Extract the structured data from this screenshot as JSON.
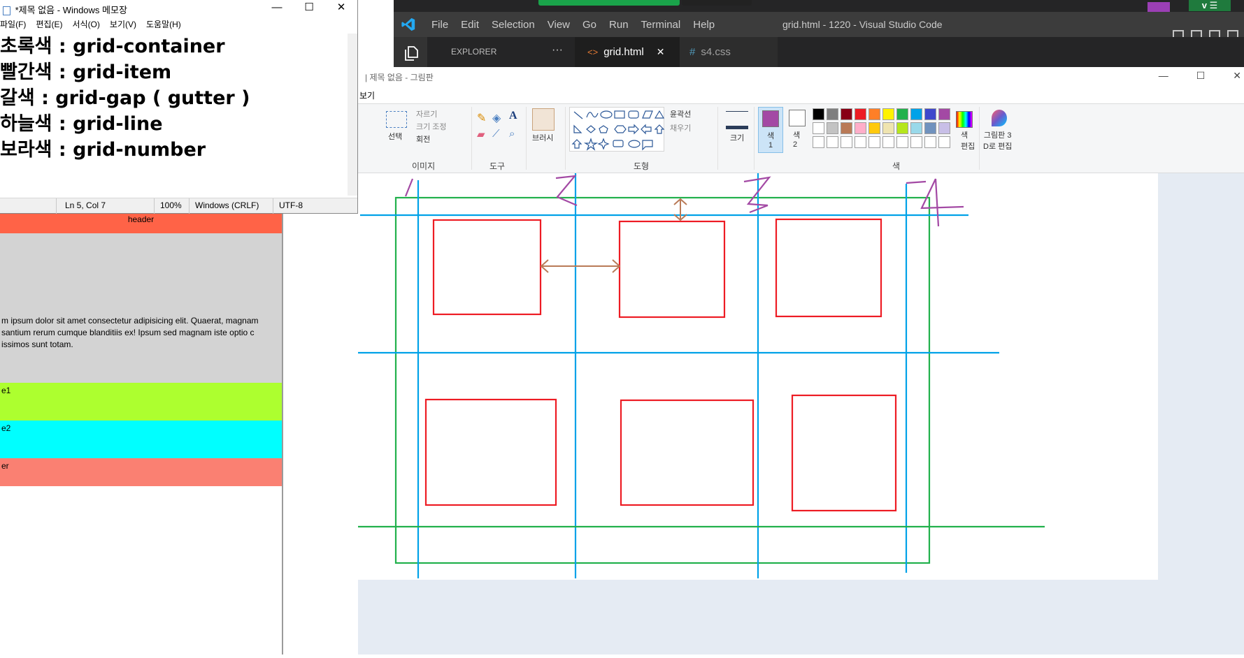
{
  "vscode": {
    "menu": [
      "File",
      "Edit",
      "Selection",
      "View",
      "Go",
      "Run",
      "Terminal",
      "Help"
    ],
    "title": "grid.html - 1220 - Visual Studio Code",
    "explorer_label": "EXPLORER",
    "explorer_more": "···",
    "tabs": [
      {
        "label": "grid.html",
        "icon": "html-file-icon",
        "active": true
      },
      {
        "label": "s4.css",
        "icon": "css-file-icon",
        "active": false
      }
    ],
    "tab_close": "✕",
    "tray_badge": "v ☰"
  },
  "notepad": {
    "title": "*제목 없음 - Windows 메모장",
    "menu": [
      "파일(F)",
      "편집(E)",
      "서식(O)",
      "보기(V)",
      "도움말(H)"
    ],
    "lines": [
      "초록색 : grid-container",
      "빨간색 : grid-item",
      "갈색 : grid-gap ( gutter )",
      "하늘색 : grid-line",
      "보라색 : grid-number"
    ],
    "status": {
      "position": "Ln 5, Col 7",
      "zoom": "100%",
      "eol": "Windows (CRLF)",
      "encoding": "UTF-8"
    }
  },
  "browser": {
    "header": "header",
    "main_text": "m ipsum dolor sit amet consectetur adipisicing elit. Quaerat, magnam santium rerum cumque blanditiis ex! Ipsum sed magnam iste optio c issimos sunt totam.",
    "side1": "e1",
    "side2": "e2",
    "footer": "er",
    "colors": {
      "header": "#ff6347",
      "main": "#d3d3d3",
      "side1": "#adff2f",
      "side2": "#00ffff",
      "footer": "#fa8072"
    }
  },
  "paint": {
    "title": "| 제목 없음 - 그림판",
    "tab_view": "보기",
    "groups": {
      "image": "이미지",
      "tools": "도구",
      "shapes": "도형",
      "colors": "색"
    },
    "image_tools": {
      "select": "선택",
      "crop": "자르기",
      "resize": "크기 조정",
      "rotate": "회전"
    },
    "brush": "브러시",
    "outline": "윤곽선",
    "fill": "채우기",
    "size": "크기",
    "color1": "색\n1",
    "color2": "색\n2",
    "edit_colors": "색\n편집",
    "paint3d": "그림판 3\nD로 편집",
    "palette": [
      "#000000",
      "#7f7f7f",
      "#880015",
      "#ed1c24",
      "#ff7f27",
      "#fff200",
      "#22b14c",
      "#00a2e8",
      "#3f48cc",
      "#a349a4",
      "#ffffff",
      "#c3c3c3",
      "#b97a57",
      "#ffaec9",
      "#ffc90e",
      "#efe4b0",
      "#b5e61d",
      "#99d9ea",
      "#7092be",
      "#c8bfe7"
    ],
    "colors": {
      "container": "#22b14c",
      "item": "#ed1c24",
      "gap": "#b97a57",
      "line": "#00a2e8",
      "number": "#a349a4"
    }
  }
}
